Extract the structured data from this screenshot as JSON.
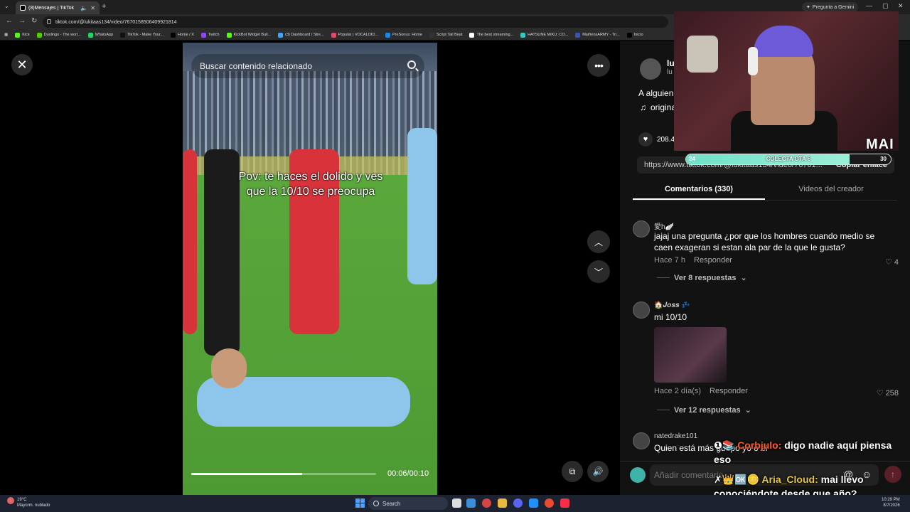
{
  "browser": {
    "tab_title": "(8)Mensajes | TikTok",
    "url": "tiktok.com/@lukitaas134/video/7670158506409921814",
    "gemini_label": "Pregunta a Gemini",
    "bookmarks": [
      {
        "label": "Kick",
        "color": "#53fc18"
      },
      {
        "label": "Duolingo - The worl...",
        "color": "#58cc02"
      },
      {
        "label": "WhatsApp",
        "color": "#25d366"
      },
      {
        "label": "TikTok - Make Your...",
        "color": "#111111"
      },
      {
        "label": "Home / X",
        "color": "#000000"
      },
      {
        "label": "Twitch",
        "color": "#9146ff"
      },
      {
        "label": "KickBot Widget Buil...",
        "color": "#53fc18"
      },
      {
        "label": "(3) Dashboard / Stre...",
        "color": "#3ea6ff"
      },
      {
        "label": "Popular | VOCALOID...",
        "color": "#e04a6a"
      },
      {
        "label": "PreSonus: Home",
        "color": "#1e88e5"
      },
      {
        "label": "Script Tail Beat",
        "color": "#333333"
      },
      {
        "label": "The best streaming...",
        "color": "#ffffff"
      },
      {
        "label": "HATSUNE MIKU: CO...",
        "color": "#39c5bb"
      },
      {
        "label": "MaifrensARMY - Tri...",
        "color": "#3f51b5"
      },
      {
        "label": "Inicio",
        "color": "#000000"
      }
    ]
  },
  "video": {
    "search_placeholder": "Buscar contenido relacionado",
    "caption_line1": "Pov: te haces el dolido y ves",
    "caption_line2": "que la 10/10 se preocupa",
    "time": "00:06/00:10",
    "progress": 0.6
  },
  "panel": {
    "author_name": "lu",
    "author_handle": "lu",
    "description": "A alguien",
    "music": "origina",
    "likes": "208.4",
    "link": "https://www.tiktok.com/@lukitaas134/video/76701...",
    "copy_label": "Copiar enlace",
    "tab_comments": "Comentarios (330)",
    "tab_videos": "Videos del creador"
  },
  "comments": [
    {
      "user": "愛h🪽",
      "text": "jajaj una pregunta ¿por que los hombres cuando medio se caen exageran si estan ala par de la que le gusta?",
      "time": "Hace 7 h",
      "reply": "Responder",
      "likes": "4",
      "replies": "Ver 8 respuestas"
    },
    {
      "user": "🏠𝑱𝒐𝒔𝒔 💤",
      "text": "mi 10/10",
      "time": "Hace 2 día(s)",
      "reply": "Responder",
      "likes": "258",
      "replies": "Ver 12 respuestas"
    },
    {
      "user": "natedrake101",
      "text": "Quien está más guapo yo o el"
    }
  ],
  "add_comment": {
    "placeholder": "Añadir comentario..."
  },
  "stream": {
    "badge": "MAI",
    "goal_label": "COLECTA GTA 6",
    "goal_min": "24",
    "goal_max": "30",
    "goal_progress": 0.8,
    "chat": [
      {
        "user": "Corbjulo:",
        "message": "digo nadie aquí piensa eso"
      },
      {
        "user": "Aria_Cloud:",
        "message": "mai llevo conociéndote desde que año?"
      }
    ]
  },
  "taskbar": {
    "weather_temp": "19°C",
    "weather_desc": "Mayorm. nublado",
    "search_label": "Search",
    "time": "10:29 PM",
    "date": "8/7/2026"
  },
  "colors": {
    "panel_bg": "#121212",
    "chat_user1": "#ff5a2c",
    "chat_user2": "#e5c64a",
    "goal_fill": "#6fe0c8"
  }
}
